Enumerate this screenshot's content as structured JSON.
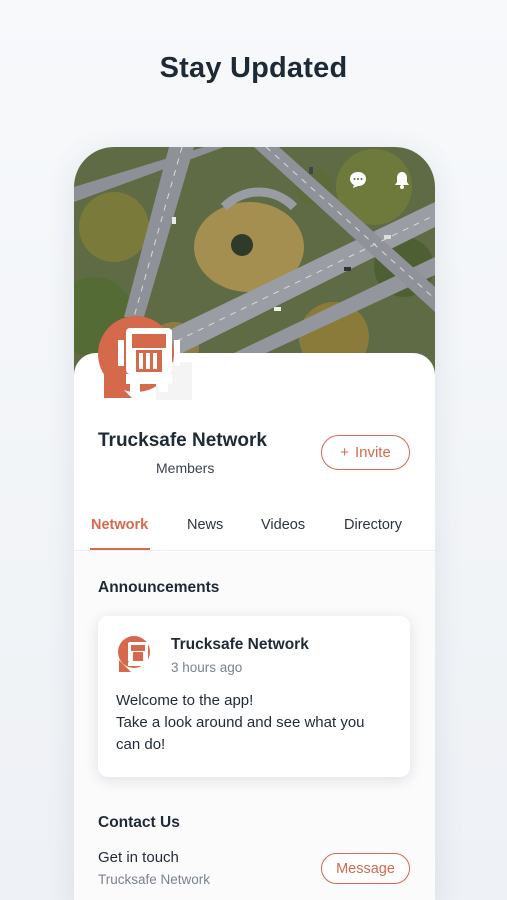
{
  "headline": "Stay Updated",
  "colors": {
    "accent": "#d46a4f",
    "text": "#1f2a36",
    "muted": "#7a828c"
  },
  "header_icons": [
    "chat-icon",
    "bell-icon"
  ],
  "group": {
    "name": "Trucksafe Network",
    "members_label": "Members",
    "invite_label": "Invite"
  },
  "tabs": [
    {
      "label": "Network",
      "active": true
    },
    {
      "label": "News"
    },
    {
      "label": "Videos"
    },
    {
      "label": "Directory"
    }
  ],
  "announcements": {
    "title": "Announcements",
    "post": {
      "author": "Trucksafe Network",
      "time": "3 hours ago",
      "lines": [
        "Welcome to the app!",
        "Take a look around and see what you",
        "can do!"
      ]
    }
  },
  "contact": {
    "title": "Contact Us",
    "line1": "Get in touch",
    "line2": "Trucksafe Network",
    "button_label": "Message"
  }
}
